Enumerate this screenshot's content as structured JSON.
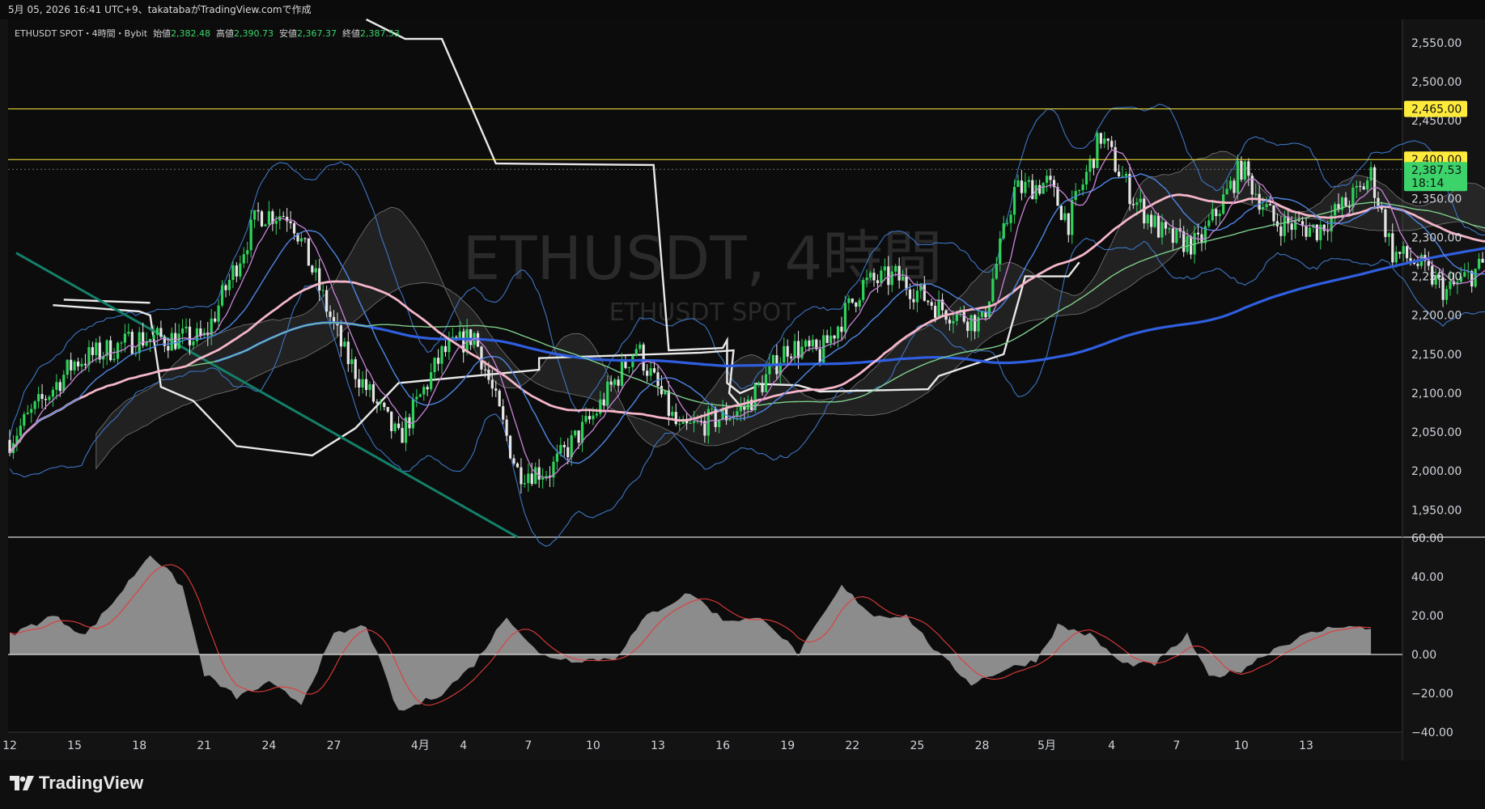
{
  "header": {
    "title": "5月 05, 2026 16:41 UTC+9、takatabaがTradingView.comで作成"
  },
  "legend": {
    "symbol": "ETHUSDT SPOT・4時間・Bybit",
    "open_label": "始値",
    "open": "2,382.48",
    "high_label": "高値",
    "high": "2,390.73",
    "low_label": "安値",
    "low": "2,367.37",
    "close_label": "終値",
    "close": "2,387.53"
  },
  "watermark": {
    "main": "ETHUSDT, 4時間",
    "sub": "ETHUSDT SPOT"
  },
  "price_axis": {
    "labels": [
      "2,550.00",
      "2,500.00",
      "2,450.00",
      "2,400.00",
      "2,350.00",
      "2,300.00",
      "2,250.00",
      "2,200.00",
      "2,150.00",
      "2,100.00",
      "2,050.00",
      "2,000.00",
      "1,950.00"
    ],
    "levels": [
      "2,465.00",
      "2,400.00"
    ],
    "current_price": "2,387.53",
    "countdown": "18:14"
  },
  "osc_axis": {
    "labels": [
      "60.00",
      "40.00",
      "20.00",
      "0.00",
      "−20.00",
      "−40.00"
    ]
  },
  "time_axis": {
    "labels": [
      "12",
      "15",
      "18",
      "21",
      "24",
      "27",
      "4月",
      "4",
      "7",
      "10",
      "13",
      "16",
      "19",
      "22",
      "25",
      "28",
      "5月",
      "4",
      "7",
      "10",
      "13"
    ]
  },
  "brand": {
    "name": "TradingView"
  },
  "colors": {
    "background": "#131313",
    "up": "#2fd35b",
    "down": "#e6e6e6",
    "level_line": "#ffeb3b",
    "price_tag": "#3cd36b",
    "ma_blue": "#2f5fe0",
    "ma_pink": "#f4b6c8",
    "ma_green": "#7fce8c",
    "ma_purple": "#c983d9",
    "bollinger": "#3d75c4",
    "white_line": "#e9e9e9",
    "trendline": "#138068",
    "osc_fill": "#8c8c8c",
    "osc_signal": "#e23b3b"
  },
  "chart_data": {
    "type": "candlestick",
    "symbol": "ETHUSDT SPOT",
    "timeframe": "4時間",
    "ylim": [
      1915,
      2580
    ],
    "oscillator_ylim": [
      -40,
      60
    ],
    "horizontal_levels": [
      2465,
      2400
    ],
    "last_price": 2387.53,
    "candle_anchors": [
      {
        "t": 0,
        "p": 2040
      },
      {
        "t": 3,
        "p": 2140
      },
      {
        "t": 6,
        "p": 2170
      },
      {
        "t": 9,
        "p": 2170
      },
      {
        "t": 11.5,
        "p": 2330
      },
      {
        "t": 13,
        "p": 2330
      },
      {
        "t": 15.5,
        "p": 2150
      },
      {
        "t": 18,
        "p": 2040
      },
      {
        "t": 20,
        "p": 2150
      },
      {
        "t": 21.5,
        "p": 2175
      },
      {
        "t": 23.5,
        "p": 2000
      },
      {
        "t": 25,
        "p": 2000
      },
      {
        "t": 27,
        "p": 2070
      },
      {
        "t": 29,
        "p": 2160
      },
      {
        "t": 31,
        "p": 2050
      },
      {
        "t": 34,
        "p": 2080
      },
      {
        "t": 36,
        "p": 2160
      },
      {
        "t": 37.5,
        "p": 2150
      },
      {
        "t": 39.5,
        "p": 2240
      },
      {
        "t": 41,
        "p": 2250
      },
      {
        "t": 43,
        "p": 2210
      },
      {
        "t": 45,
        "p": 2190
      },
      {
        "t": 46.5,
        "p": 2360
      },
      {
        "t": 48,
        "p": 2370
      },
      {
        "t": 49,
        "p": 2320
      },
      {
        "t": 50.5,
        "p": 2430
      },
      {
        "t": 52,
        "p": 2350
      },
      {
        "t": 53.5,
        "p": 2300
      },
      {
        "t": 55,
        "p": 2290
      },
      {
        "t": 57,
        "p": 2390
      },
      {
        "t": 58.5,
        "p": 2320
      },
      {
        "t": 60.5,
        "p": 2310
      },
      {
        "t": 62.5,
        "p": 2360
      },
      {
        "t": 63,
        "p": 2380
      },
      {
        "t": 64,
        "p": 2280
      },
      {
        "t": 65,
        "p": 2270
      },
      {
        "t": 66.5,
        "p": 2230
      },
      {
        "t": 68,
        "p": 2260
      },
      {
        "t": 69.5,
        "p": 2300
      },
      {
        "t": 71,
        "p": 2310
      },
      {
        "t": 72.5,
        "p": 2380
      },
      {
        "t": 73.5,
        "p": 2385
      }
    ],
    "oscillator_anchors": [
      {
        "t": 0,
        "v": 10
      },
      {
        "t": 2,
        "v": 20
      },
      {
        "t": 3.5,
        "v": 10
      },
      {
        "t": 5,
        "v": 30
      },
      {
        "t": 6.5,
        "v": 52
      },
      {
        "t": 8,
        "v": 35
      },
      {
        "t": 9,
        "v": -10
      },
      {
        "t": 10.5,
        "v": -22
      },
      {
        "t": 12,
        "v": -15
      },
      {
        "t": 13.5,
        "v": -25
      },
      {
        "t": 15,
        "v": 10
      },
      {
        "t": 16.5,
        "v": 15
      },
      {
        "t": 18,
        "v": -30
      },
      {
        "t": 20,
        "v": -20
      },
      {
        "t": 21.5,
        "v": -5
      },
      {
        "t": 23,
        "v": 20
      },
      {
        "t": 24.5,
        "v": 0
      },
      {
        "t": 26,
        "v": -3
      },
      {
        "t": 28,
        "v": -2
      },
      {
        "t": 29.5,
        "v": 20
      },
      {
        "t": 31.5,
        "v": 32
      },
      {
        "t": 33,
        "v": 18
      },
      {
        "t": 35,
        "v": 18
      },
      {
        "t": 36.5,
        "v": 0
      },
      {
        "t": 38.5,
        "v": 35
      },
      {
        "t": 40,
        "v": 20
      },
      {
        "t": 41.5,
        "v": 20
      },
      {
        "t": 43,
        "v": 0
      },
      {
        "t": 44.5,
        "v": -15
      },
      {
        "t": 46,
        "v": -8
      },
      {
        "t": 47.5,
        "v": -3
      },
      {
        "t": 48.5,
        "v": 15
      },
      {
        "t": 50,
        "v": 10
      },
      {
        "t": 51.5,
        "v": -5
      },
      {
        "t": 53,
        "v": -5
      },
      {
        "t": 54.5,
        "v": 10
      },
      {
        "t": 55.5,
        "v": -12
      },
      {
        "t": 57,
        "v": -8
      },
      {
        "t": 58.5,
        "v": 3
      },
      {
        "t": 60,
        "v": 10
      },
      {
        "t": 61.5,
        "v": 15
      },
      {
        "t": 63,
        "v": 13
      }
    ]
  }
}
